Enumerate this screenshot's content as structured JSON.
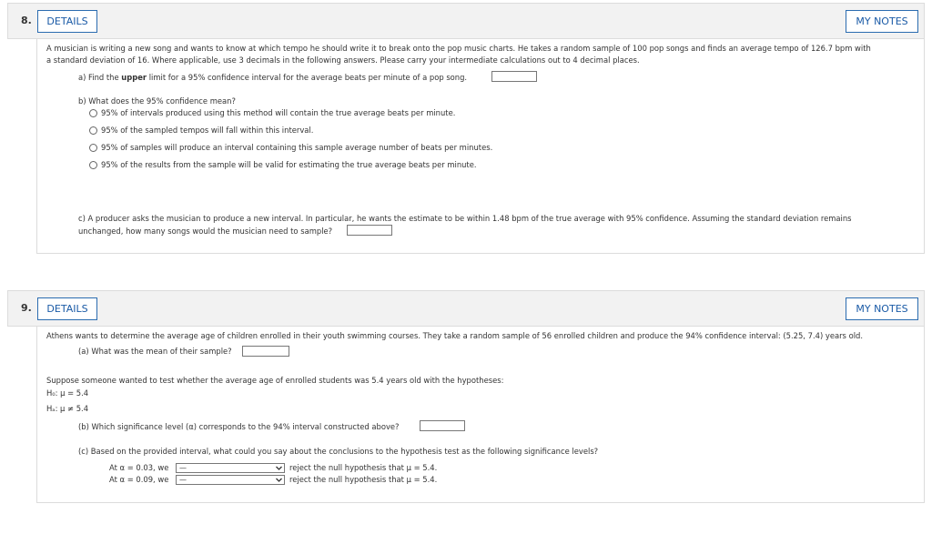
{
  "q8": {
    "number": "8.",
    "details_label": "DETAILS",
    "notes_label": "MY NOTES",
    "intro_line1": "A musician is writing a new song and wants to know at which tempo he should write it to break onto the pop music charts. He takes a random sample of 100 pop songs and finds an average tempo of 126.7 bpm with",
    "intro_line2": "a standard deviation of 16. Where applicable, use 3 decimals in the following answers. Please carry your intermediate calculations out to 4 decimal places.",
    "a_prefix": "a) Find the ",
    "a_bold": "upper",
    "a_suffix": " limit for a 95% confidence interval for the average beats per minute of a pop song.",
    "b_question": "b) What does the 95% confidence mean?",
    "options": [
      "95% of intervals produced using this method will contain the true average beats per minute.",
      "95% of the sampled tempos will fall within this interval.",
      "95% of samples will produce an interval containing this sample average number of beats per minutes.",
      "95% of the results from the sample will be valid for estimating the true average beats per minute."
    ],
    "c_line1": "c) A producer asks the musician to produce a new interval. In particular, he wants the estimate to be within 1.48 bpm of the true average with 95% confidence. Assuming the standard deviation remains",
    "c_line2": "unchanged, how many songs would the musician need to sample?"
  },
  "q9": {
    "number": "9.",
    "details_label": "DETAILS",
    "notes_label": "MY NOTES",
    "intro": "Athens wants to determine the average age of children enrolled in their youth swimming courses. They take a random sample of 56 enrolled children and produce the 94% confidence interval: (5.25, 7.4) years old.",
    "a_question": "(a) What was the mean of their sample?",
    "suppose": "Suppose someone wanted to test whether the average age of enrolled students was 5.4 years old with the hypotheses:",
    "h0": "H₀: μ = 5.4",
    "ha": "Hₐ: μ ≠ 5.4",
    "b_question": "(b) Which significance level (α) corresponds to the 94% interval constructed above?",
    "c_question": "(c) Based on the provided interval, what could you say about the conclusions to the hypothesis test as the following significance levels?",
    "row1_prefix": "At α = 0.03, we",
    "row2_prefix": "At α = 0.09, we",
    "select_value": "—",
    "row_suffix": "reject the null hypothesis that μ = 5.4."
  }
}
